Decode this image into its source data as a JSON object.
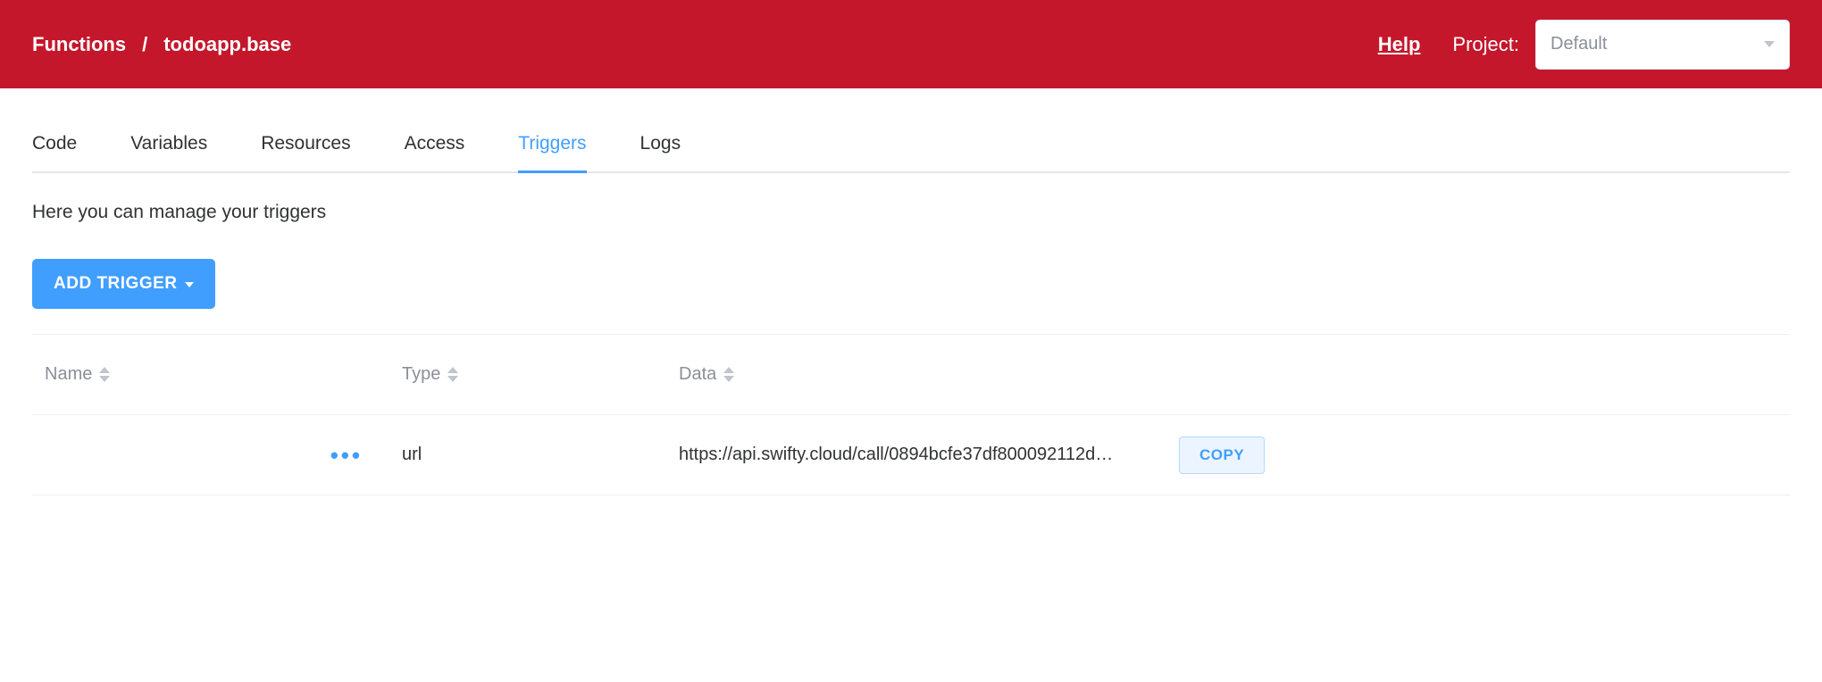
{
  "header": {
    "breadcrumb": {
      "root": "Functions",
      "separator": "/",
      "current": "todoapp.base"
    },
    "help_label": "Help",
    "project_label": "Project:",
    "project_selected": "Default"
  },
  "tabs": [
    {
      "label": "Code",
      "active": false
    },
    {
      "label": "Variables",
      "active": false
    },
    {
      "label": "Resources",
      "active": false
    },
    {
      "label": "Access",
      "active": false
    },
    {
      "label": "Triggers",
      "active": true
    },
    {
      "label": "Logs",
      "active": false
    }
  ],
  "page": {
    "description": "Here you can manage your triggers",
    "add_trigger_label": "ADD TRIGGER"
  },
  "table": {
    "columns": {
      "name": "Name",
      "type": "Type",
      "data": "Data"
    },
    "rows": [
      {
        "name": "",
        "type": "url",
        "data": "https://api.swifty.cloud/call/0894bcfe37df800092112d…",
        "copy_label": "COPY"
      }
    ]
  }
}
